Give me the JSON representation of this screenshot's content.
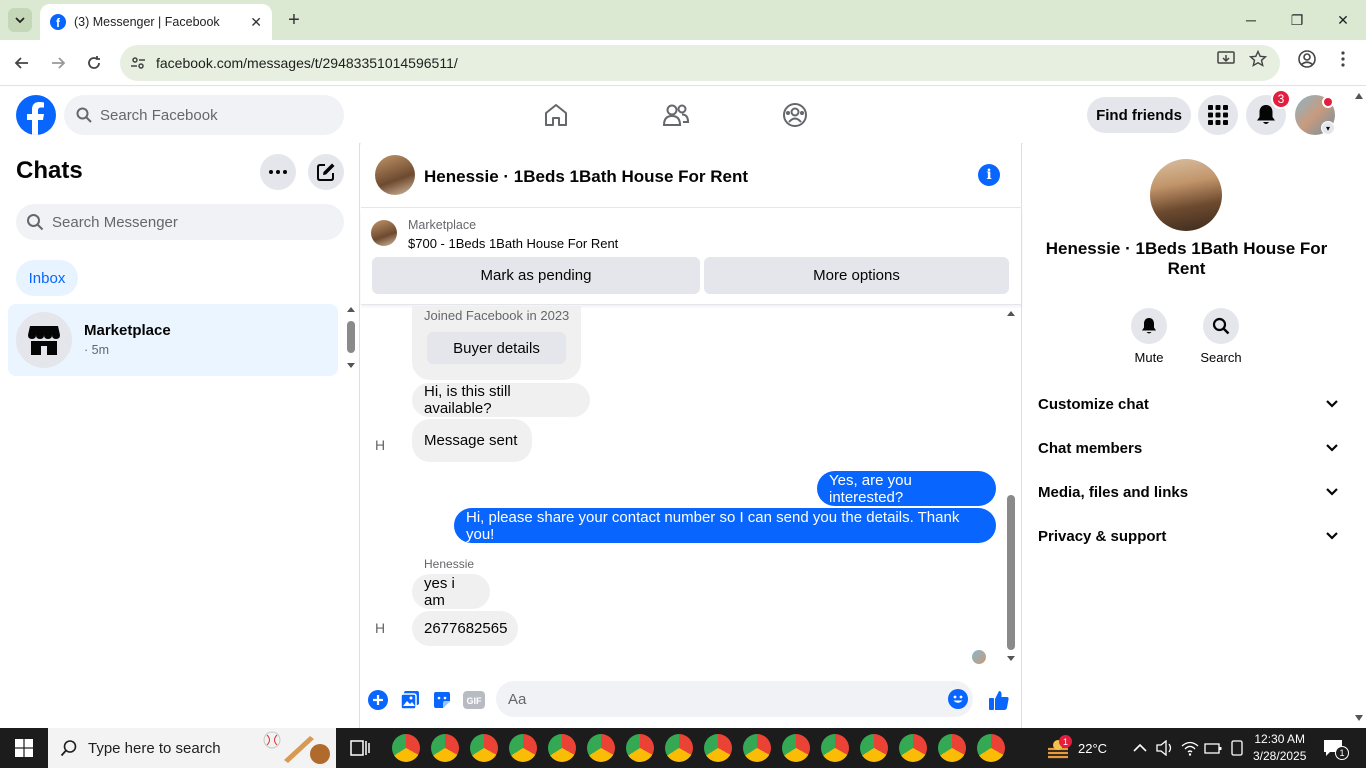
{
  "browser": {
    "tab_title": "(3) Messenger | Facebook",
    "url": "facebook.com/messages/t/29483351014596511/"
  },
  "fb_header": {
    "search_placeholder": "Search Facebook",
    "find_friends": "Find friends",
    "notification_count": "3"
  },
  "sidebar": {
    "title": "Chats",
    "search_placeholder": "Search Messenger",
    "filter": "Inbox",
    "chats": [
      {
        "name": "Marketplace",
        "time": "· 5m"
      }
    ]
  },
  "conversation": {
    "title": "Henessie · 1Beds 1Bath House For Rent",
    "marketplace_label": "Marketplace",
    "listing": "$700 - 1Beds 1Bath House For Rent",
    "mark_pending": "Mark as pending",
    "more_options": "More options",
    "joined": "Joined Facebook in 2023",
    "buyer_details": "Buyer details",
    "messages": [
      {
        "from": "them",
        "text": "Hi, is this still available?"
      },
      {
        "from": "them",
        "text": "Message sent"
      },
      {
        "from": "me",
        "text": "Yes, are you interested?"
      },
      {
        "from": "me",
        "text": "Hi, please share your contact number so I can send you the details. Thank you!"
      },
      {
        "from": "them",
        "sender": "Henessie",
        "text": "yes i am"
      },
      {
        "from": "them",
        "text": "2677682565"
      }
    ],
    "avatar_alt": "H",
    "composer_placeholder": "Aa"
  },
  "right_panel": {
    "name": "Henessie · 1Beds 1Bath House For Rent",
    "actions": [
      "Mute",
      "Search"
    ],
    "sections": [
      "Customize chat",
      "Chat members",
      "Media, files and links",
      "Privacy & support"
    ]
  },
  "taskbar": {
    "search_placeholder": "Type here to search",
    "weather_badge": "1",
    "temperature": "22°C",
    "time": "12:30 AM",
    "date": "3/28/2025",
    "notifications": "1"
  },
  "colors": {
    "fb_blue": "#0866ff",
    "chrome_green": "#dbe9d3",
    "bubble_gray": "#f0f0f0",
    "badge_red": "#e41e3f"
  }
}
